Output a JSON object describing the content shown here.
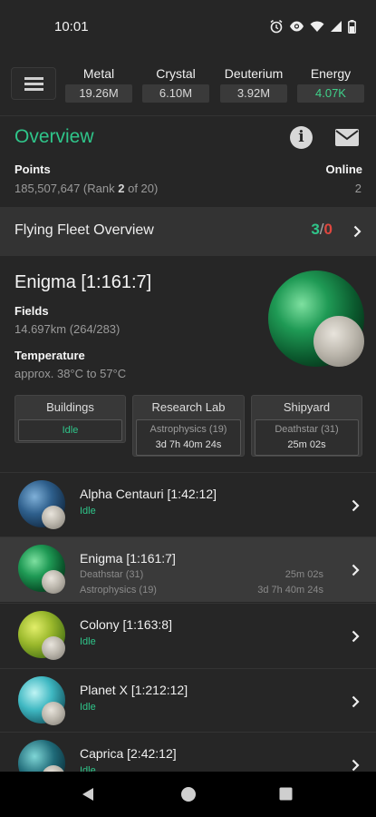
{
  "status": {
    "time": "10:01"
  },
  "resources": [
    {
      "label": "Metal",
      "value": "19.26M"
    },
    {
      "label": "Crystal",
      "value": "6.10M"
    },
    {
      "label": "Deuterium",
      "value": "3.92M"
    },
    {
      "label": "Energy",
      "value": "4.07K",
      "color": "#3fd18a"
    }
  ],
  "overview": {
    "title": "Overview",
    "points_label": "Points",
    "points_value": "185,507,647",
    "rank_prefix": "(Rank",
    "rank_value": "2",
    "rank_suffix": "of 20)",
    "online_label": "Online",
    "online_value": "2"
  },
  "fleet": {
    "title": "Flying Fleet Overview",
    "own": "3",
    "sep": "/",
    "hostile": "0"
  },
  "current_planet": {
    "name": "Enigma [1:161:7]",
    "fields_label": "Fields",
    "fields_value": "14.697km (264/283)",
    "temp_label": "Temperature",
    "temp_value": "approx. 38°C to 57°C"
  },
  "queues": {
    "buildings": {
      "title": "Buildings",
      "status": "Idle"
    },
    "research": {
      "title": "Research Lab",
      "item": "Astrophysics (19)",
      "time": "3d 7h 40m 24s"
    },
    "shipyard": {
      "title": "Shipyard",
      "item": "Deathstar (31)",
      "time": "25m 02s"
    }
  },
  "planets": [
    {
      "name": "Alpha Centauri [1:42:12]",
      "status": "Idle"
    },
    {
      "name": "Enigma [1:161:7]",
      "line1": "Deathstar (31)",
      "time1": "25m 02s",
      "line2": "Astrophysics (19)",
      "time2": "3d 7h 40m 24s"
    },
    {
      "name": "Colony [1:163:8]",
      "status": "Idle"
    },
    {
      "name": "Planet X [1:212:12]",
      "status": "Idle"
    },
    {
      "name": "Caprica [2:42:12]",
      "status": "Idle"
    }
  ],
  "icons": {
    "menu": "hamburger-menu-icon",
    "info": "info-icon",
    "mail": "envelope-icon",
    "chevron": "chevron-right-icon",
    "alarm": "alarm-icon",
    "eye": "eye-icon",
    "wifi": "wifi-icon",
    "signal": "signal-icon",
    "battery": "battery-icon",
    "back": "back-triangle-icon",
    "home": "home-circle-icon",
    "recents": "recents-square-icon"
  },
  "colors": {
    "accent": "#2fc58a",
    "hostile": "#e0473f",
    "background": "#262626"
  }
}
